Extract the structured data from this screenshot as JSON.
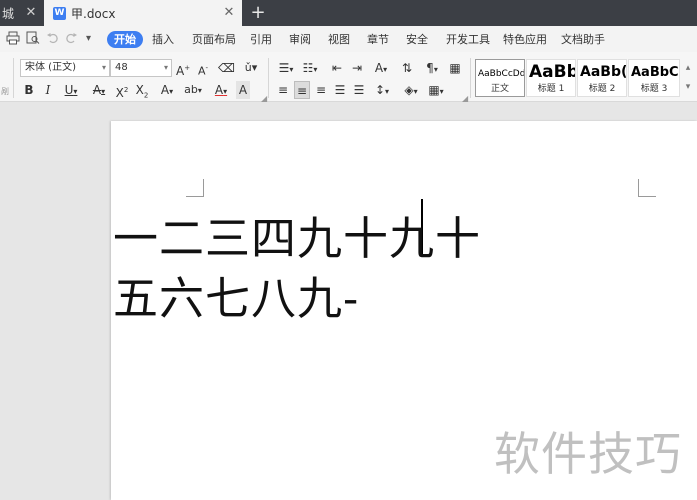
{
  "tabs": {
    "prev": {
      "label": "城"
    },
    "active": {
      "icon": "W",
      "label": "甲.docx"
    },
    "close_glyph": "✕",
    "add_glyph": "+"
  },
  "menu": {
    "items": [
      "开始",
      "插入",
      "页面布局",
      "引用",
      "审阅",
      "视图",
      "章节",
      "安全",
      "开发工具",
      "特色应用",
      "文档助手"
    ],
    "active_index": 0
  },
  "ribbon": {
    "font_name": "宋体 (正文)",
    "font_size": "48",
    "styles": [
      {
        "preview": "AaBbCcDd",
        "name": "正文"
      },
      {
        "preview": "AaBb",
        "name": "标题 1"
      },
      {
        "preview": "AaBb(",
        "name": "标题 2"
      },
      {
        "preview": "AaBbC",
        "name": "标题 3"
      }
    ]
  },
  "document": {
    "line1": "一二三四九十九十",
    "line2": "五六七八九-"
  },
  "watermark": "软件技巧",
  "colors": {
    "accent": "#3d7ef1",
    "tabbar": "#3c3f45"
  }
}
